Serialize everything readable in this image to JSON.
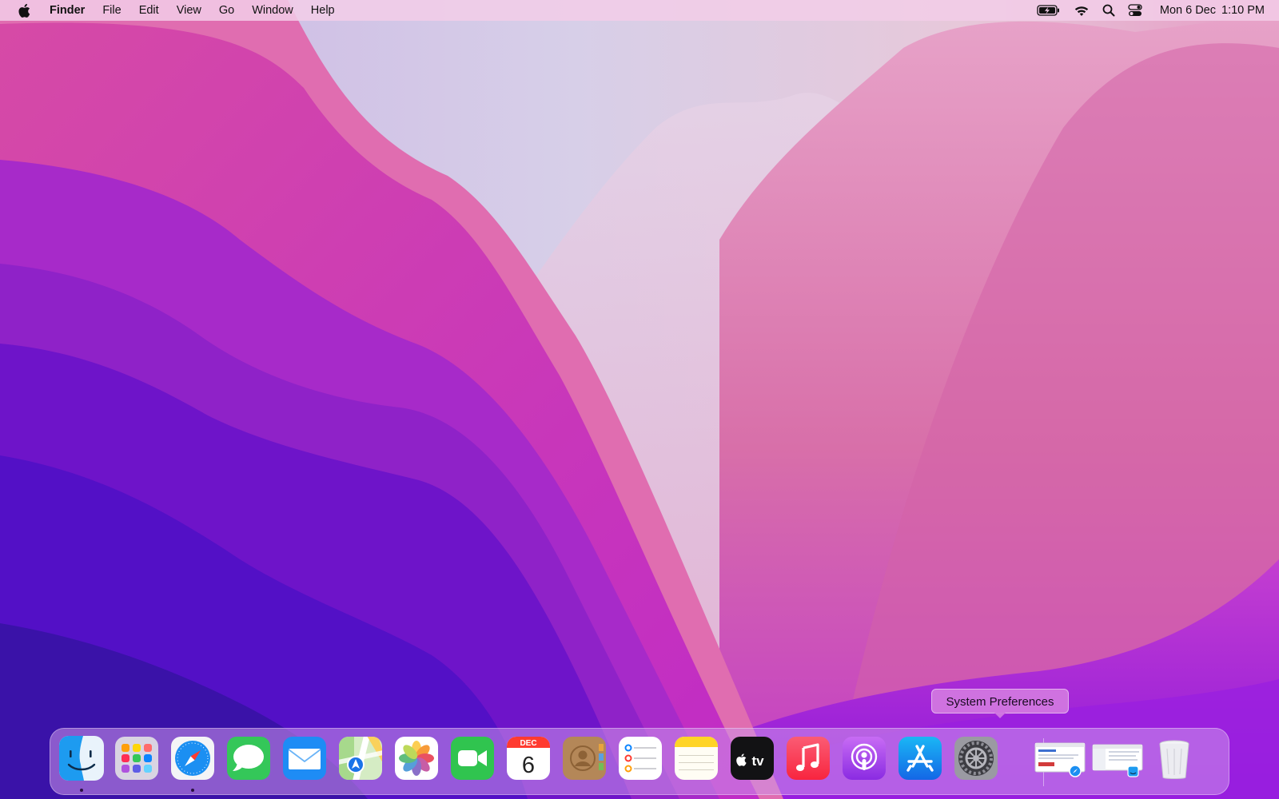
{
  "menubar": {
    "app_name": "Finder",
    "menus": [
      "File",
      "Edit",
      "View",
      "Go",
      "Window",
      "Help"
    ],
    "status_icons": [
      "battery-charging-icon",
      "wifi-icon",
      "spotlight-search-icon",
      "control-center-icon"
    ],
    "clock": {
      "date": "Mon 6 Dec",
      "time": "1:10 PM"
    }
  },
  "tooltip": {
    "text": "System Preferences"
  },
  "dock": {
    "calendar": {
      "month": "DEC",
      "day": "6"
    },
    "appletv_label": "tv",
    "items": [
      {
        "name": "Finder",
        "icon": "finder-icon",
        "running": true
      },
      {
        "name": "Launchpad",
        "icon": "launchpad-icon",
        "running": false
      },
      {
        "name": "Safari",
        "icon": "safari-icon",
        "running": true
      },
      {
        "name": "Messages",
        "icon": "messages-icon",
        "running": false
      },
      {
        "name": "Mail",
        "icon": "mail-icon",
        "running": false
      },
      {
        "name": "Maps",
        "icon": "maps-icon",
        "running": false
      },
      {
        "name": "Photos",
        "icon": "photos-icon",
        "running": false
      },
      {
        "name": "FaceTime",
        "icon": "facetime-icon",
        "running": false
      },
      {
        "name": "Calendar",
        "icon": "calendar-icon",
        "running": false
      },
      {
        "name": "Contacts",
        "icon": "contacts-icon",
        "running": false
      },
      {
        "name": "Reminders",
        "icon": "reminders-icon",
        "running": false
      },
      {
        "name": "Notes",
        "icon": "notes-icon",
        "running": false
      },
      {
        "name": "TV",
        "icon": "apple-tv-icon",
        "running": false
      },
      {
        "name": "Music",
        "icon": "music-icon",
        "running": false
      },
      {
        "name": "Podcasts",
        "icon": "podcasts-icon",
        "running": false
      },
      {
        "name": "App Store",
        "icon": "app-store-icon",
        "running": false
      },
      {
        "name": "System Preferences",
        "icon": "system-preferences-icon",
        "running": false
      }
    ],
    "minimized_windows": [
      "safari-window-thumbnail-icon",
      "finder-window-thumbnail-icon"
    ],
    "trash": {
      "name": "Trash",
      "icon": "trash-icon"
    }
  }
}
